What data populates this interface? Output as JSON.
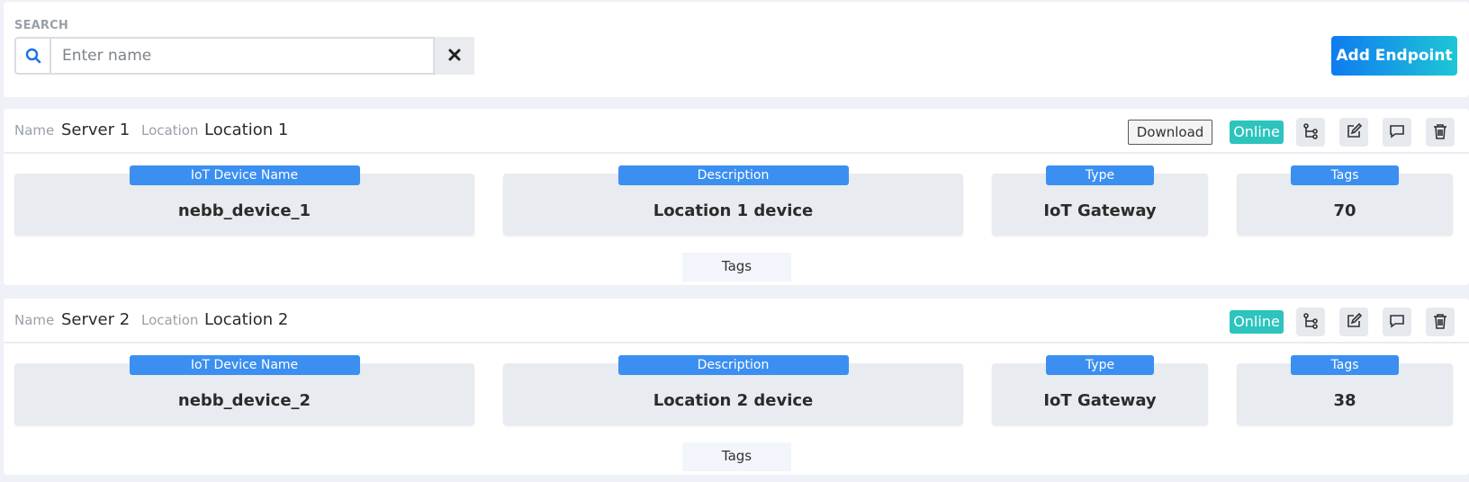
{
  "search": {
    "label": "SEARCH",
    "placeholder": "Enter name",
    "value": ""
  },
  "toolbar": {
    "add_label": "Add Endpoint"
  },
  "field_labels": {
    "name": "Name",
    "location": "Location",
    "device_name": "IoT Device Name",
    "description": "Description",
    "type": "Type",
    "tags": "Tags"
  },
  "endpoints": [
    {
      "name": "Server 1",
      "location": "Location 1",
      "download_label": "Download",
      "status": "Online",
      "device_name": "nebb_device_1",
      "description": "Location 1 device",
      "type": "IoT Gateway",
      "tags_count": "70",
      "tags_link": "Tags"
    },
    {
      "name": "Server 2",
      "location": "Location 2",
      "status": "Online",
      "device_name": "nebb_device_2",
      "description": "Location 2 device",
      "type": "IoT Gateway",
      "tags_count": "38",
      "tags_link": "Tags"
    }
  ],
  "icons": {
    "search": "search-icon",
    "clear": "close-icon",
    "topology": "topology-icon",
    "edit": "edit-icon",
    "comment": "comment-icon",
    "delete": "trash-icon"
  },
  "colors": {
    "accent": "#0f7bf0",
    "accent_end": "#1ec6d6",
    "status_online": "#2cc4bc",
    "pill": "#3b8ff0"
  }
}
